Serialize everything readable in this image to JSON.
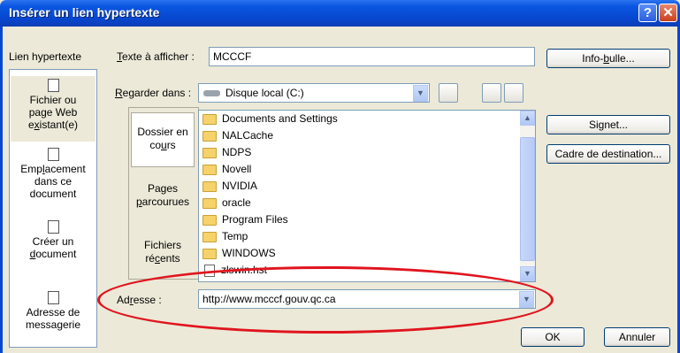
{
  "window": {
    "title": "Insérer un lien hypertexte"
  },
  "titlebar": {
    "help_glyph": "?",
    "close_glyph": "✕"
  },
  "labels": {
    "link_to": "Lien hypertexte",
    "text_to_display_u": "T",
    "text_to_display_rest": "exte à afficher :",
    "look_in_u": "R",
    "look_in_rest": "egarder dans :",
    "address_pre": "Ad",
    "address_u": "r",
    "address_post": "esse :"
  },
  "inputs": {
    "text_to_display": "MCCCF",
    "look_in": "Disque local (C:)",
    "address": "http://www.mcccf.gouv.qc.ca"
  },
  "sidebar": {
    "items": [
      {
        "line1": "Fichier ou",
        "line2": "page Web",
        "line3_pre": "e",
        "line3_u": "x",
        "line3_post": "istant(e)"
      },
      {
        "line1_pre": "Emp",
        "line1_u": "l",
        "line1_post": "acement",
        "line2": "dans ce",
        "line3": "document"
      },
      {
        "line1": "Créer un",
        "line2_u": "d",
        "line2_post": "ocument"
      },
      {
        "line1": "Adresse de",
        "line2": "messagerie"
      }
    ]
  },
  "nav_tabs": [
    {
      "line1": "Dossier en",
      "line2_pre": "co",
      "line2_u": "u",
      "line2_post": "rs"
    },
    {
      "line1": "Pages",
      "line2_u": "p",
      "line2_post": "arcourues"
    },
    {
      "line1": "Fichiers",
      "line2_pre": "ré",
      "line2_u": "c",
      "line2_post": "ents"
    }
  ],
  "files": [
    "Documents and Settings",
    "NALCache",
    "NDPS",
    "Novell",
    "NVIDIA",
    "oracle",
    "Program Files",
    "Temp",
    "WINDOWS",
    "zlswin.hst"
  ],
  "buttons": {
    "screentip_pre": "Info-",
    "screentip_u": "b",
    "screentip_post": "ulle...",
    "bookmark_pre": "Si",
    "bookmark_u": "g",
    "bookmark_post": "net...",
    "target_frame": "Cadre de destination...",
    "ok": "OK",
    "cancel": "Annuler"
  },
  "colors": {
    "title_bar": "#0a55e0",
    "highlight_ring": "#e0141e",
    "dialog_bg": "#ece9d8"
  }
}
